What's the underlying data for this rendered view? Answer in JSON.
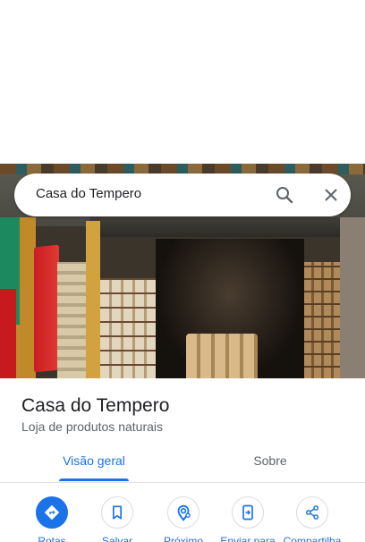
{
  "search": {
    "query": "Casa do Tempero"
  },
  "place": {
    "name": "Casa do Tempero",
    "category": "Loja de produtos naturais"
  },
  "tabs": [
    {
      "label": "Visão geral",
      "active": true
    },
    {
      "label": "Sobre",
      "active": false
    }
  ],
  "actions": [
    {
      "label": "Rotas",
      "icon": "directions-icon"
    },
    {
      "label": "Salvar",
      "icon": "bookmark-icon"
    },
    {
      "label": "Próximo",
      "icon": "nearby-icon"
    },
    {
      "label": "Enviar para",
      "icon": "send-to-phone-icon"
    },
    {
      "label": "Compartilha",
      "icon": "share-icon"
    }
  ],
  "colors": {
    "accent": "#1a73e8",
    "text_primary": "#202124",
    "text_secondary": "#5f6368"
  }
}
